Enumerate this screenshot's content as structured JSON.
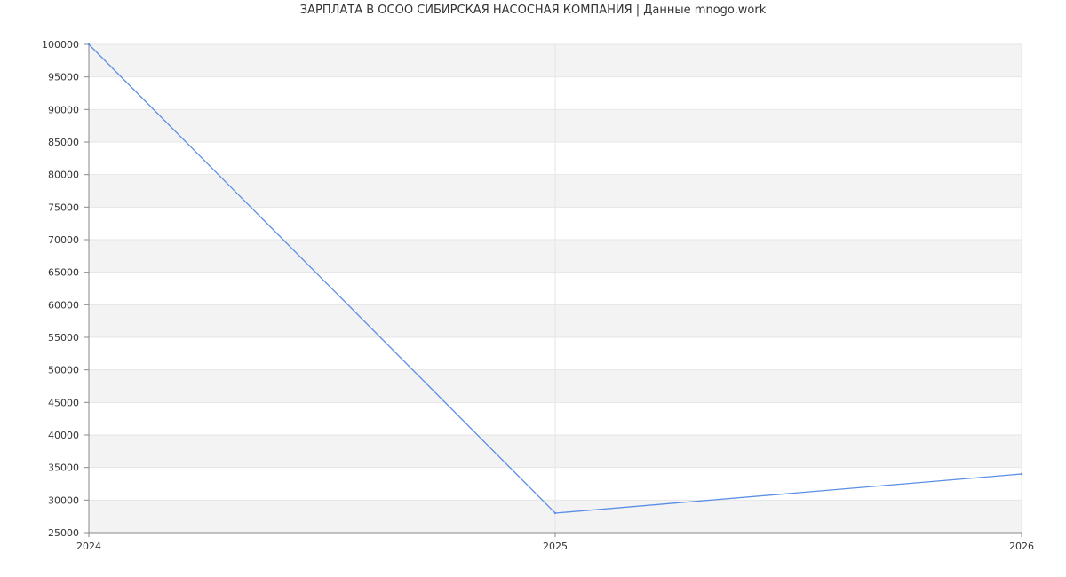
{
  "chart_data": {
    "type": "line",
    "title": "ЗАРПЛАТА В ОСОО СИБИРСКАЯ НАСОСНАЯ КОМПАНИЯ | Данные mnogo.work",
    "xlabel": "",
    "ylabel": "",
    "x": [
      "2024",
      "2025",
      "2026"
    ],
    "series": [
      {
        "values": [
          100000,
          28000,
          34000
        ],
        "color": "#5b8ee6"
      }
    ],
    "ylim": [
      25000,
      100000
    ],
    "yticks": [
      25000,
      30000,
      35000,
      40000,
      45000,
      50000,
      55000,
      60000,
      65000,
      70000,
      75000,
      80000,
      85000,
      90000,
      95000,
      100000
    ],
    "grid": true,
    "band_color": "#f3f3f3",
    "grid_color": "#e6e6e6",
    "axis_color": "#888888"
  }
}
